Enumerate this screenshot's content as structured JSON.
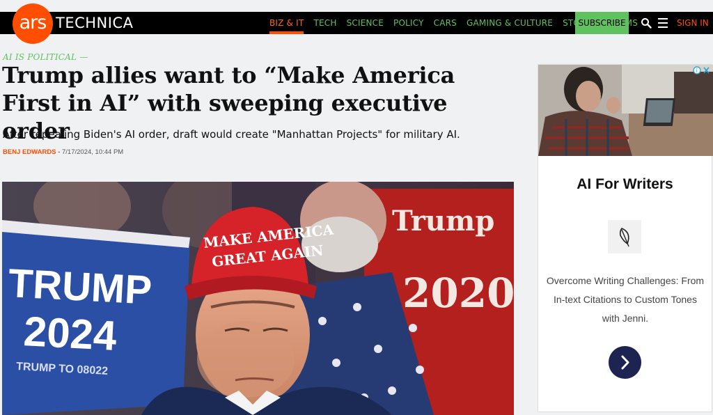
{
  "site": {
    "logo_circle": "ars",
    "logo_word": "TECHNICA"
  },
  "nav": {
    "items": [
      {
        "label": "BIZ & IT",
        "active": true
      },
      {
        "label": "TECH"
      },
      {
        "label": "SCIENCE"
      },
      {
        "label": "POLICY"
      },
      {
        "label": "CARS"
      },
      {
        "label": "GAMING & CULTURE"
      },
      {
        "label": "STORE"
      },
      {
        "label": "FORUMS"
      }
    ],
    "subscribe": "SUBSCRIBE",
    "sign_in": "SIGN IN",
    "accent": "#ff4e00",
    "green": "#5fc25f"
  },
  "article": {
    "kicker": "AI IS POLITICAL —",
    "headline": "Trump allies want to “Make America First in AI” with sweeping executive order",
    "dek": "After repealing Biden's AI order, draft would create \"Manhattan Projects\" for military AI.",
    "author": "BENJ EDWARDS",
    "date": "7/17/2024, 10:44 PM",
    "hero": {
      "hat_text_1": "MAKE AMERICA",
      "hat_text_2": "GREAT AGAIN",
      "sign_left_1": "TRUMP",
      "sign_left_2": "2024",
      "sign_left_3": "TRUMP TO 08022",
      "sign_right_1": "Trump",
      "sign_right_2": "2020"
    }
  },
  "ad": {
    "title": "AI For Writers",
    "body": "Overcome Writing Challenges: From In-text Citations to Custom Tones with Jenni.",
    "icons": [
      "info-icon",
      "close-icon",
      "quill-icon",
      "chevron-right-icon"
    ]
  }
}
